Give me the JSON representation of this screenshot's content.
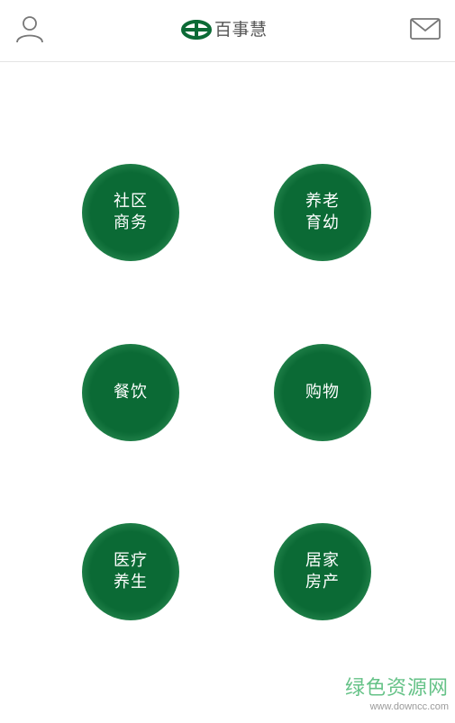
{
  "header": {
    "user_icon": "user-icon",
    "mail_icon": "mail-icon",
    "logo_text": "百事慧"
  },
  "colors": {
    "brand_green": "#0b6a35",
    "text_gray": "#555555"
  },
  "menu": [
    {
      "line1": "社区",
      "line2": "商务"
    },
    {
      "line1": "养老",
      "line2": "育幼"
    },
    {
      "line1": "餐饮",
      "line2": ""
    },
    {
      "line1": "购物",
      "line2": ""
    },
    {
      "line1": "医疗",
      "line2": "养生"
    },
    {
      "line1": "居家",
      "line2": "房产"
    }
  ],
  "watermark": {
    "title": "绿色资源网",
    "url": "www.downcc.com"
  }
}
